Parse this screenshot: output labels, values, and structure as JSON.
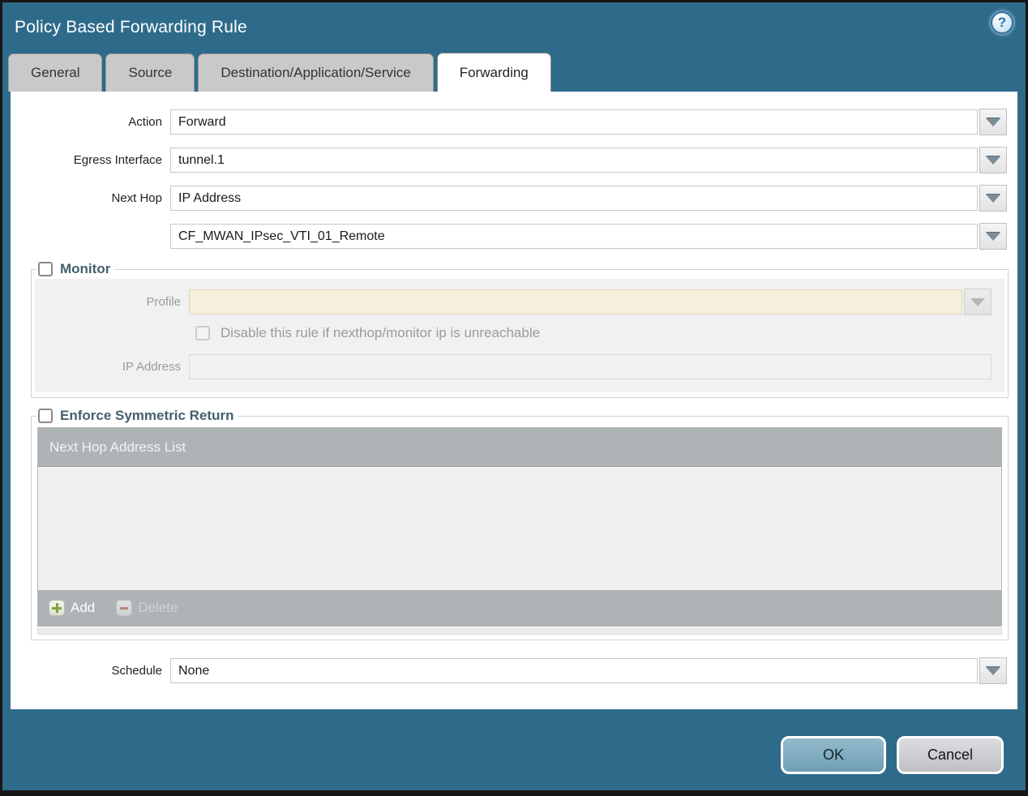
{
  "dialog": {
    "title": "Policy Based Forwarding Rule",
    "help_glyph": "?"
  },
  "tabs": [
    {
      "label": "General",
      "active": false
    },
    {
      "label": "Source",
      "active": false
    },
    {
      "label": "Destination/Application/Service",
      "active": false
    },
    {
      "label": "Forwarding",
      "active": true
    }
  ],
  "form": {
    "action": {
      "label": "Action",
      "value": "Forward"
    },
    "egress_interface": {
      "label": "Egress Interface",
      "value": "tunnel.1"
    },
    "next_hop": {
      "label": "Next Hop",
      "value": "IP Address"
    },
    "next_hop_address": {
      "value": "CF_MWAN_IPsec_VTI_01_Remote"
    },
    "schedule": {
      "label": "Schedule",
      "value": "None"
    }
  },
  "monitor": {
    "legend": "Monitor",
    "checked": false,
    "profile": {
      "label": "Profile",
      "value": ""
    },
    "disable_rule": {
      "label": "Disable this rule if nexthop/monitor ip is unreachable",
      "checked": false
    },
    "ip_address": {
      "label": "IP Address",
      "value": ""
    }
  },
  "symmetric_return": {
    "legend": "Enforce Symmetric Return",
    "checked": false,
    "table": {
      "header": "Next Hop Address List",
      "rows": [],
      "add_label": "Add",
      "delete_label": "Delete",
      "delete_enabled": false
    }
  },
  "footer": {
    "ok_label": "OK",
    "cancel_label": "Cancel"
  },
  "colors": {
    "dialog_teal": "#2e6b8b",
    "active_tab_bg": "#ffffff",
    "inactive_tab_bg": "#c9c9c9",
    "legend_text": "#44606e",
    "disabled_field_cream": "#f6efdc",
    "table_chrome_gray": "#aeb3b6",
    "ok_button_blue": "#7fafc4",
    "cancel_button_gray": "#c9c9cd",
    "add_icon_green": "#7fa33c",
    "delete_icon_red": "#b5867c"
  }
}
